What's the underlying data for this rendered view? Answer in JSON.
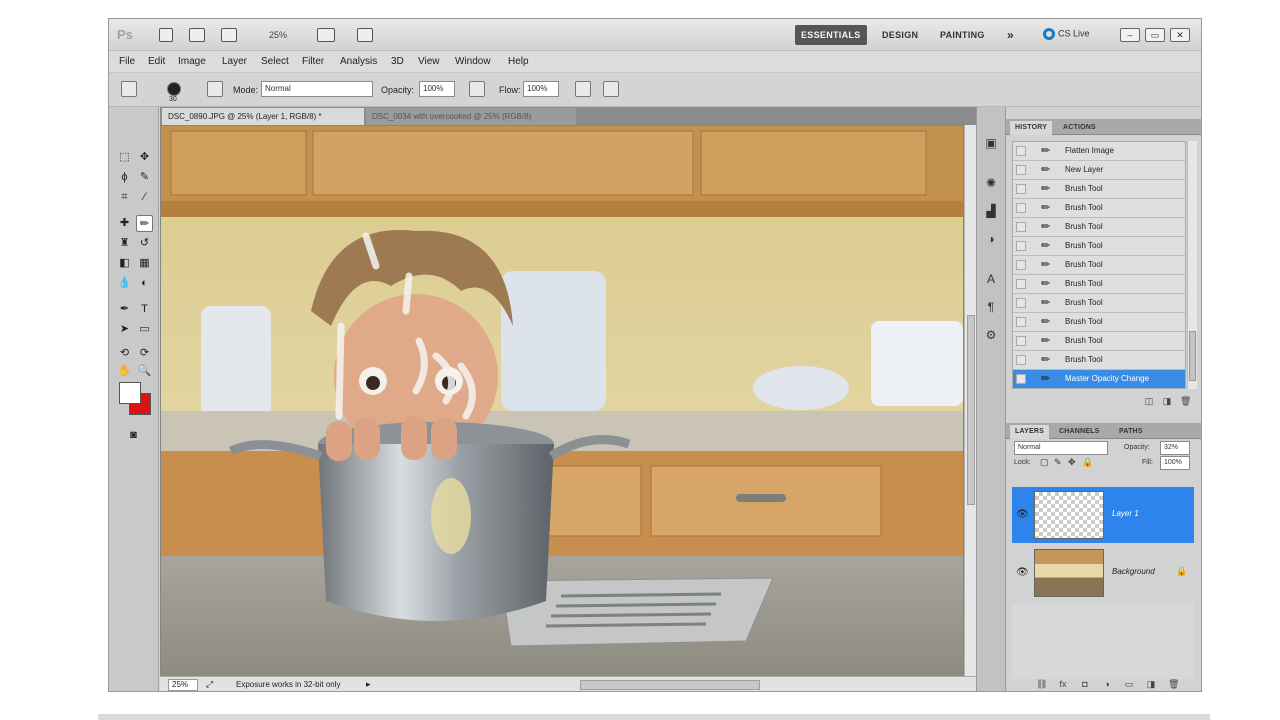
{
  "app": {
    "zoom": "25%",
    "workspaces": [
      "ESSENTIALS",
      "DESIGN",
      "PAINTING"
    ],
    "more_workspaces": "»",
    "cs_live": "CS Live"
  },
  "menu": [
    "File",
    "Edit",
    "Image",
    "Layer",
    "Select",
    "Filter",
    "Analysis",
    "3D",
    "View",
    "Window",
    "Help"
  ],
  "options": {
    "brush_size": "30",
    "mode_label": "Mode:",
    "mode_value": "Normal",
    "opacity_label": "Opacity:",
    "opacity_value": "100%",
    "flow_label": "Flow:",
    "flow_value": "100%"
  },
  "documents": {
    "tabs": [
      "DSC_0890.JPG @ 25% (Layer 1, RGB/8) *",
      "DSC_0034 with overcooked @ 25% (RGB/8)"
    ]
  },
  "status": {
    "zoom": "25%",
    "info": "Exposure works in 32-bit only"
  },
  "panels": {
    "top_tabs": [
      "HISTORY",
      "ACTIONS"
    ],
    "history": [
      "Flatten Image",
      "New Layer",
      "Brush Tool",
      "Brush Tool",
      "Brush Tool",
      "Brush Tool",
      "Brush Tool",
      "Brush Tool",
      "Brush Tool",
      "Brush Tool",
      "Brush Tool",
      "Brush Tool",
      "Master Opacity Change"
    ],
    "layer_tabs": [
      "LAYERS",
      "CHANNELS",
      "PATHS"
    ],
    "blend_mode": "Normal",
    "opacity_label": "Opacity:",
    "opacity_value": "32%",
    "lock_label": "Lock:",
    "fill_label": "Fill:",
    "fill_value": "100%",
    "layers": [
      {
        "name": "Layer 1",
        "selected": true
      },
      {
        "name": "Background",
        "selected": false
      }
    ]
  },
  "colors": {
    "foreground": "#ffffff",
    "background": "#d8141a",
    "selection": "#2d84ea"
  }
}
